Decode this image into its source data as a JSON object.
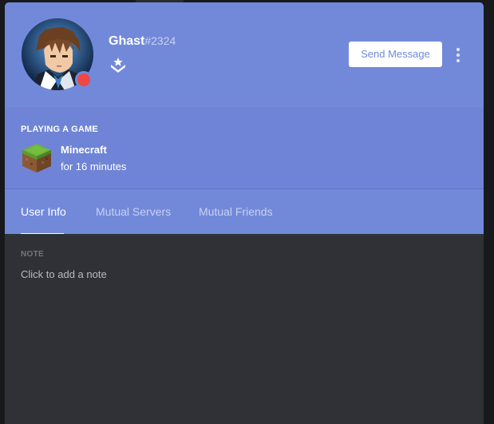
{
  "user": {
    "username": "Ghast",
    "discriminator": "#2324",
    "status_color": "#f04747"
  },
  "header": {
    "send_message_label": "Send Message",
    "more_icon": "vertical-dots-icon",
    "badge_icon": "hypesquad-badge-icon",
    "accent_color": "#7289da"
  },
  "activity": {
    "title": "PLAYING A GAME",
    "game_name": "Minecraft",
    "elapsed": "for 16 minutes",
    "game_icon": "minecraft-grass-block-icon"
  },
  "tabs": [
    {
      "label": "User Info",
      "active": true
    },
    {
      "label": "Mutual Servers",
      "active": false
    },
    {
      "label": "Mutual Friends",
      "active": false
    }
  ],
  "note": {
    "label": "NOTE",
    "placeholder": "Click to add a note"
  }
}
